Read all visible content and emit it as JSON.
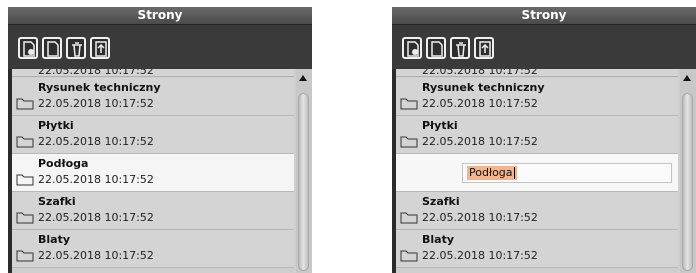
{
  "left_panel": {
    "title": "Strony",
    "toolbar": [
      {
        "icon": "new-page-icon",
        "label": ""
      },
      {
        "icon": "page-icon",
        "label": ""
      },
      {
        "icon": "delete-page-icon",
        "label": ""
      },
      {
        "icon": "upload-page-icon",
        "label": ""
      }
    ],
    "rows": [
      {
        "name": "",
        "date": "22.05.2018 10:17:52"
      },
      {
        "name": "Rysunek techniczny",
        "date": "22.05.2018 10:17:52"
      },
      {
        "name": "Płytki",
        "date": "22.05.2018 10:17:52"
      },
      {
        "name": "Podłoga",
        "date": "22.05.2018 10:17:52",
        "selected": true
      },
      {
        "name": "Szafki",
        "date": "22.05.2018 10:17:52"
      },
      {
        "name": "Blaty",
        "date": "22.05.2018 10:17:52"
      }
    ]
  },
  "right_panel": {
    "title": "Strony",
    "rows": [
      {
        "name": "",
        "date": "22.05.2018 10:17:52"
      },
      {
        "name": "Rysunek techniczny",
        "date": "22.05.2018 10:17:52"
      },
      {
        "name": "Płytki",
        "date": "22.05.2018 10:17:52"
      },
      {
        "name": "Podłoga",
        "editing": true
      },
      {
        "name": "Szafki",
        "date": "22.05.2018 10:17:52"
      },
      {
        "name": "Blaty",
        "date": "22.05.2018 10:17:52"
      }
    ]
  },
  "colors": {
    "selection_highlight": "#f6b48a",
    "header_bg": "#4a4a4a"
  }
}
